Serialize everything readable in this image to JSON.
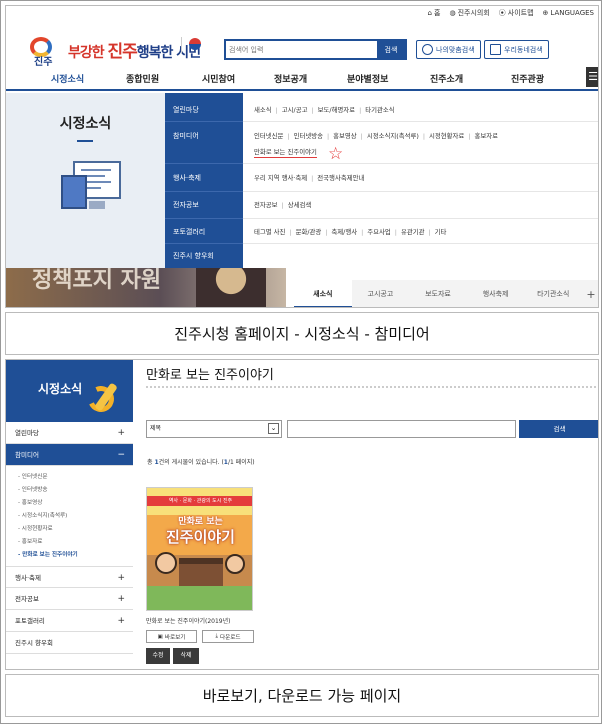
{
  "panel1": {
    "util_links": [
      "홈",
      "진주시의회",
      "사이트맵",
      "LANGUAGES"
    ],
    "logo": {
      "city": "진주",
      "slogan_pre": "부강한 ",
      "slogan_city": "진주",
      "slogan_post": "행복한 시민"
    },
    "search": {
      "placeholder": "검색어 입력",
      "button": "검색"
    },
    "my_search_button": "나의맞춤검색",
    "town_info_button": "우리동네검색",
    "gnb": [
      "시정소식",
      "종합민원",
      "시민참여",
      "정보공개",
      "분야별정보",
      "진주소개",
      "진주관광"
    ],
    "mega": {
      "title": "시정소식",
      "categories": [
        "열린마당",
        "참미디어",
        "행사·축제",
        "전자공보",
        "포토갤러리",
        "진주시 향우회"
      ],
      "subs": {
        "r1": [
          "새소식",
          "고시/공고",
          "보도/해명자료",
          "타기관소식"
        ],
        "r2": [
          "인터넷신문",
          "인터넷방송",
          "홍보영상",
          "시정소식지(촉석루)",
          "시정현황자료",
          "홍보자료"
        ],
        "r2b": "만화로 보는 진주이야기",
        "r3": [
          "우리 지역 행사·축제",
          "전국행사축제안내"
        ],
        "r4": [
          "전자공보",
          "상세검색"
        ],
        "r5": [
          "테그별 사진",
          "문화/관광",
          "축제/행사",
          "주요사업",
          "유관기관",
          "기타"
        ]
      }
    },
    "banner_text": "정책포지 자원",
    "tabs": [
      "새소식",
      "고시공고",
      "보도자료",
      "행사축제",
      "타기관소식"
    ]
  },
  "caption1": "진주시청 홈페이지 - 시정소식 - 참미디어",
  "panel2": {
    "side_title": "시정소식",
    "menu": [
      {
        "label": "열린마당",
        "sign": "+"
      },
      {
        "label": "참미디어",
        "sign": "−"
      },
      {
        "label": "행사·축제",
        "sign": "+"
      },
      {
        "label": "전자공보",
        "sign": "+"
      },
      {
        "label": "포토갤러리",
        "sign": "+"
      },
      {
        "label": "진주시 향우회",
        "sign": ""
      }
    ],
    "submenu": [
      "인터넷신문",
      "인터넷방송",
      "홍보영상",
      "시정소식지(촉석루)",
      "시정현황자료",
      "홍보자료",
      "만화로 보는 진주이야기"
    ],
    "content_title": "만화로 보는 진주이야기",
    "filter": {
      "select_value": "제목",
      "button": "검색"
    },
    "count_text": {
      "pre": "총 ",
      "count": "1",
      "mid": "건의 게시물이 있습니다. (",
      "page": "1",
      "post": "/1 페이지)"
    },
    "thumb": {
      "band": "역사 · 문화 · 관광의 도시 진주",
      "line1": "만화로 보는",
      "line2": "진주이야기"
    },
    "item_caption": "만화로 보는 진주이야기(2019년)",
    "view_button": "바로보기",
    "download_button": "다운로드",
    "edit_button": "수정",
    "delete_button": "삭제"
  },
  "caption2": "바로보기, 다운로드 가능 페이지"
}
